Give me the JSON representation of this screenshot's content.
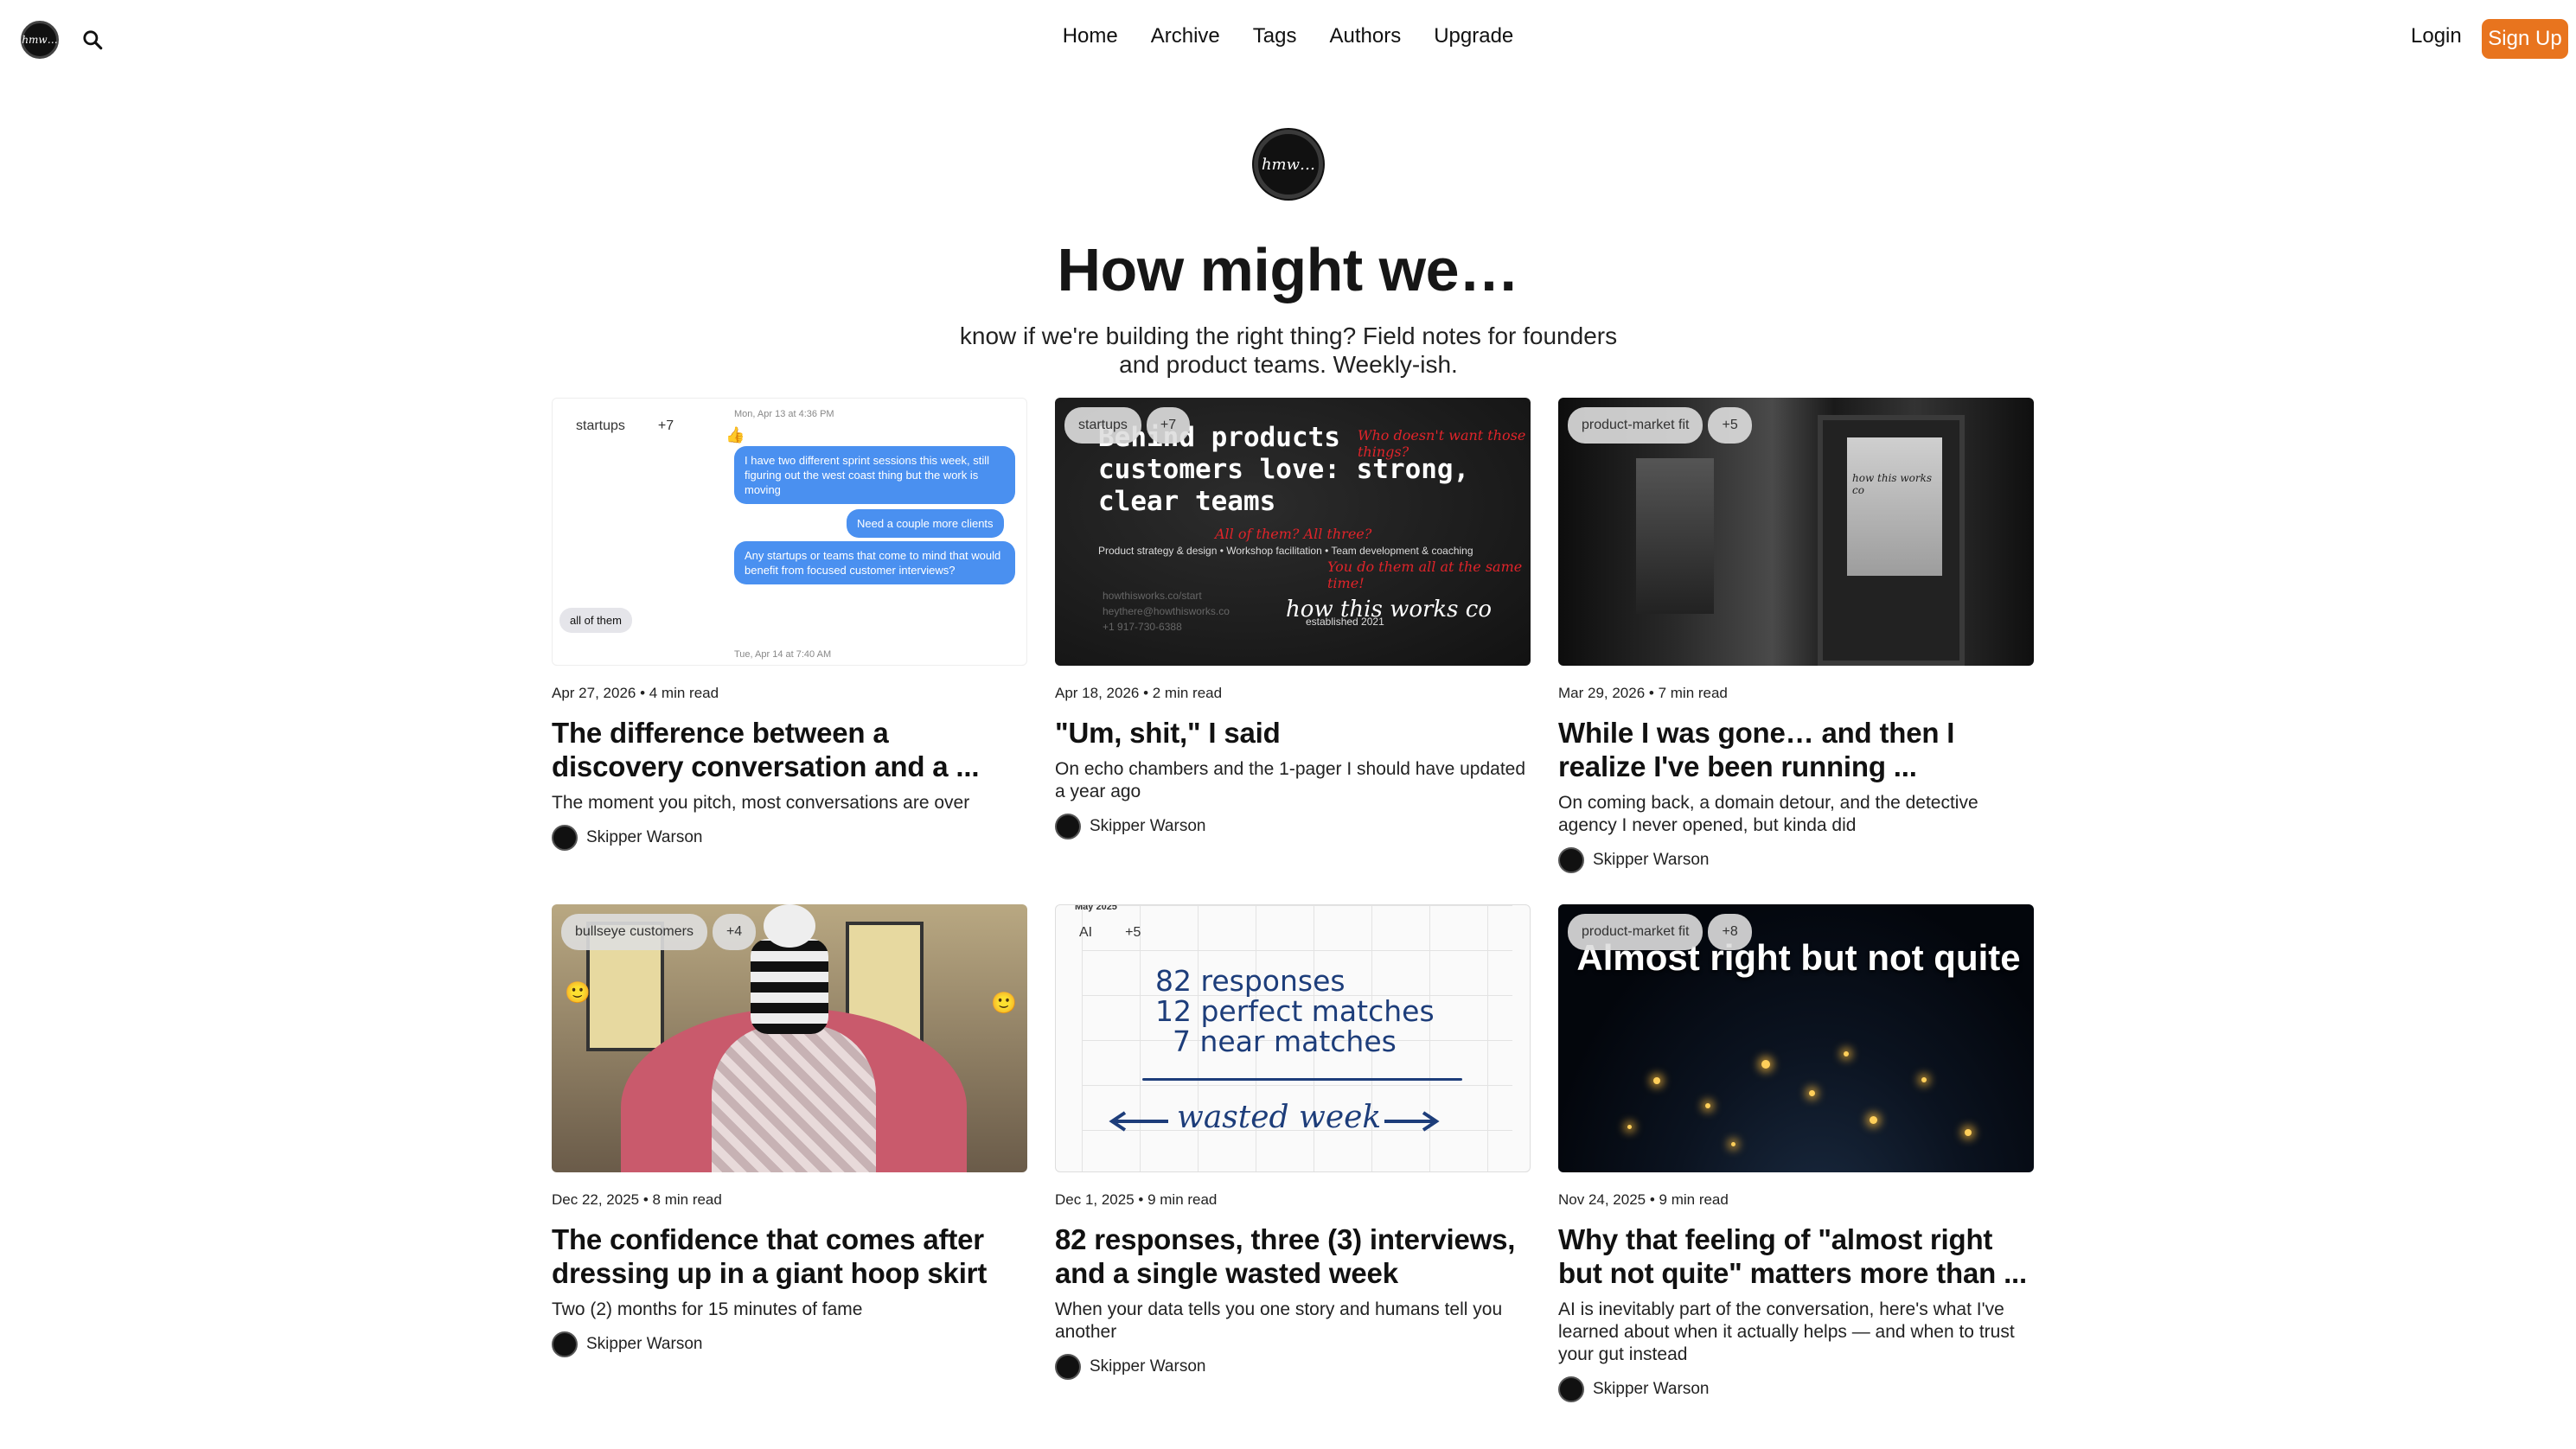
{
  "nav": {
    "logo_text": "ℎ𝑚𝑤…",
    "links": [
      "Home",
      "Archive",
      "Tags",
      "Authors",
      "Upgrade"
    ],
    "login": "Login",
    "signup": "Sign Up"
  },
  "hero": {
    "logo_text": "ℎ𝑚𝑤…",
    "title": "How might we…",
    "subtitle": "know if we're building the right thing? Field notes for founders and product teams. Weekly-ish."
  },
  "posts": [
    {
      "tags": [
        "startups",
        "+7"
      ],
      "meta": "Apr 27, 2026 • 4 min read",
      "title": "The difference between a discovery conversation and a ...",
      "desc": "The moment you pitch, most conversations are over",
      "author": "Skipper Warson",
      "thumb": {
        "stamp1": "Mon, Apr 13 at 4:36 PM",
        "bubble1": "I have two different sprint sessions this week, still figuring out the west coast thing but the work is moving",
        "bubble2": "Need a couple more clients",
        "bubble3": "Any startups or teams that come to mind that would benefit from focused customer interviews?",
        "reply": "all of them",
        "stamp2": "Tue, Apr 14 at 7:40 AM",
        "reaction": "👍"
      }
    },
    {
      "tags": [
        "startups",
        "+7"
      ],
      "meta": "Apr 18, 2026 • 2 min read",
      "title": "\"Um, shit,\" I said",
      "desc": "On echo chambers and the 1-pager I should have updated a year ago",
      "author": "Skipper Warson",
      "thumb": {
        "headline": "Behind products customers love: strong, clear teams",
        "red1": "Who doesn't want those things?",
        "red2": "All of them? All three?",
        "red3": "You do them all at the same time!",
        "services": "Product strategy & design • Workshop facilitation • Team development & coaching",
        "contact1": "howthisworks.co/start",
        "contact2": "heythere@howthisworks.co",
        "contact3": "+1 917-730-6388",
        "brand": "how this works",
        "brand_suffix": "co",
        "established": "established 2021"
      }
    },
    {
      "tags": [
        "product-market fit",
        "+5"
      ],
      "meta": "Mar 29, 2026 • 7 min read",
      "title": "While I was gone… and then I realize I've been running ...",
      "desc": "On coming back, a domain detour, and the detective agency I never opened, but kinda did",
      "author": "Skipper Warson",
      "thumb": {
        "glass_text": "how this works co"
      }
    },
    {
      "tags": [
        "bullseye customers",
        "+4"
      ],
      "meta": "Dec 22, 2025 • 8 min read",
      "title": "The confidence that comes after dressing up in a giant hoop skirt",
      "desc": "Two (2) months for 15 minutes of fame",
      "author": "Skipper Warson",
      "thumb": {
        "emoji_left": "🙂",
        "emoji_right": "🙂"
      }
    },
    {
      "tags": [
        "AI",
        "+5"
      ],
      "meta": "Dec 1, 2025 • 9 min read",
      "title": "82 responses, three (3) interviews, and a single wasted week",
      "desc": "When your data tells you one story and humans tell you another",
      "author": "Skipper Warson",
      "thumb": {
        "month": "May 2025",
        "line1": "82 responses",
        "line2": "12 perfect matches",
        "line3": "7 near matches",
        "wasted": "wasted week"
      }
    },
    {
      "tags": [
        "product-market fit",
        "+8"
      ],
      "meta": "Nov 24, 2025 • 9 min read",
      "title": "Why that feeling of \"almost right but not quite\" matters more than ...",
      "desc": "AI is inevitably part of the conversation, here's what I've learned about when it actually helps — and when to trust your gut instead",
      "author": "Skipper Warson",
      "thumb": {
        "overlay": "Almost right but not quite"
      }
    }
  ]
}
